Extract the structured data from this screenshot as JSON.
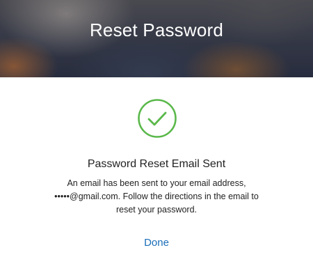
{
  "header": {
    "title": "Reset Password"
  },
  "status": {
    "icon": "check-circle-icon",
    "color": "#5ab84a"
  },
  "message": {
    "heading": "Password Reset Email Sent",
    "line1": "An email has been sent to your email address,",
    "email": "•••••@gmail.com",
    "line2_rest": ". Follow the directions in the email to",
    "line3": "reset your password."
  },
  "actions": {
    "done_label": "Done",
    "link_color": "#1a6db8"
  }
}
